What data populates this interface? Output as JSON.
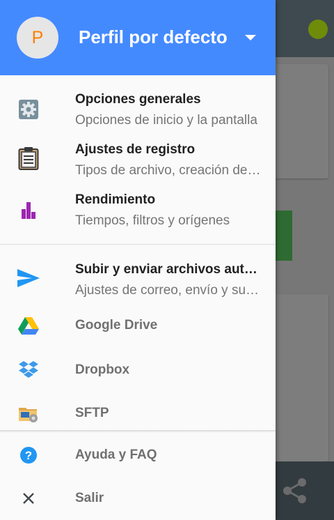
{
  "header": {
    "avatar_letter": "P",
    "profile_name": "Perfil por defecto"
  },
  "menu": {
    "general": {
      "title": "Opciones generales",
      "subtitle": "Opciones de inicio y la pantalla",
      "icon": "gear-icon"
    },
    "log": {
      "title": "Ajustes de registro",
      "subtitle": "Tipos de archivo, creación de registros",
      "icon": "clipboard-icon"
    },
    "performance": {
      "title": "Rendimiento",
      "subtitle": "Tiempos, filtros y orígenes",
      "icon": "bar-chart-icon"
    },
    "upload": {
      "title": "Subir y enviar archivos automáticamente",
      "subtitle": "Ajustes de correo, envío y subida",
      "icon": "send-icon"
    },
    "drive": {
      "label": "Google Drive",
      "icon": "google-drive-icon"
    },
    "dropbox": {
      "label": "Dropbox",
      "icon": "dropbox-icon"
    },
    "sftp": {
      "label": "SFTP",
      "icon": "sftp-folder-icon"
    },
    "help": {
      "label": "Ayuda y FAQ",
      "icon": "help-icon"
    },
    "exit": {
      "label": "Salir",
      "icon": "close-icon"
    }
  },
  "colors": {
    "header_bg": "#448aff",
    "avatar_letter": "#ff7f00",
    "performance_icon": "#9c27b0",
    "send_icon": "#2196f3",
    "help_icon": "#2196f3"
  }
}
